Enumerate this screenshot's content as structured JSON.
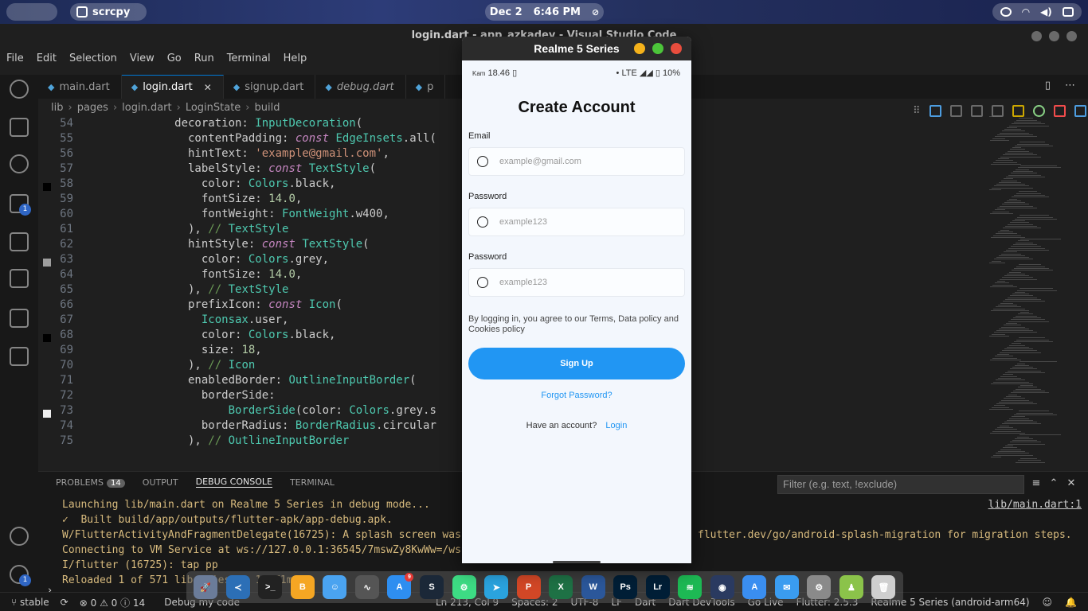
{
  "system_bar": {
    "app_name": "scrcpy",
    "date": "Dec 2",
    "time": "6:46 PM"
  },
  "vscode": {
    "title": "login.dart - app_azkadev - Visual Studio Code",
    "menu": [
      "File",
      "Edit",
      "Selection",
      "View",
      "Go",
      "Run",
      "Terminal",
      "Help"
    ],
    "activity_badges": {
      "debug": "1",
      "settings": "1"
    },
    "tabs": [
      {
        "label": "main.dart",
        "active": false
      },
      {
        "label": "login.dart",
        "active": true
      },
      {
        "label": "signup.dart",
        "active": false
      },
      {
        "label": "debug.dart",
        "active": false
      },
      {
        "label": "p",
        "active": false
      }
    ],
    "breadcrumb": [
      "lib",
      "pages",
      "login.dart",
      "LoginState",
      "build"
    ],
    "code_lines": [
      {
        "n": "54",
        "t": "            decoration: InputDecoration("
      },
      {
        "n": "55",
        "t": "              contentPadding: const EdgeInsets.all("
      },
      {
        "n": "56",
        "t": "              hintText: 'example@gmail.com',"
      },
      {
        "n": "57",
        "t": "              labelStyle: const TextStyle("
      },
      {
        "n": "58",
        "t": "                color: Colors.black,"
      },
      {
        "n": "59",
        "t": "                fontSize: 14.0,"
      },
      {
        "n": "60",
        "t": "                fontWeight: FontWeight.w400,"
      },
      {
        "n": "61",
        "t": "              ), // TextStyle"
      },
      {
        "n": "62",
        "t": "              hintStyle: const TextStyle("
      },
      {
        "n": "63",
        "t": "                color: Colors.grey,"
      },
      {
        "n": "64",
        "t": "                fontSize: 14.0,"
      },
      {
        "n": "65",
        "t": "              ), // TextStyle"
      },
      {
        "n": "66",
        "t": "              prefixIcon: const Icon("
      },
      {
        "n": "67",
        "t": "                Iconsax.user,"
      },
      {
        "n": "68",
        "t": "                color: Colors.black,"
      },
      {
        "n": "69",
        "t": "                size: 18,"
      },
      {
        "n": "70",
        "t": "              ), // Icon"
      },
      {
        "n": "71",
        "t": "              enabledBorder: OutlineInputBorder("
      },
      {
        "n": "72",
        "t": "                borderSide:"
      },
      {
        "n": "73",
        "t": "                    BorderSide(color: Colors.grey.s"
      },
      {
        "n": "74",
        "t": "                borderRadius: BorderRadius.circular"
      },
      {
        "n": "75",
        "t": "              ), // OutlineInputBorder"
      }
    ],
    "panel": {
      "tabs": [
        "PROBLEMS",
        "OUTPUT",
        "DEBUG CONSOLE",
        "TERMINAL"
      ],
      "problems_count": "14",
      "active_tab": "DEBUG CONSOLE",
      "filter_placeholder": "Filter (e.g. text, !exclude)",
      "console_lines": [
        "Launching lib/main.dart on Realme 5 Series in debug mode...",
        "✓  Built build/app/outputs/flutter-apk/app-debug.apk.",
        "W/FlutterActivityAndFragmentDelegate(16725): A splash screen was provide",
        "Connecting to VM Service at ws://127.0.0.1:36545/7mswZy8KwWw=/ws",
        "I/flutter (16725): tap pp",
        "Reloaded 1 of 571 libraries in 1,471ms."
      ],
      "console_extra": "flutter.dev/go/android-splash-migration for migration steps.",
      "console_link": "lib/main.dart:1"
    },
    "status": {
      "branch": "stable",
      "errors": "0",
      "warnings": "0",
      "info": "14",
      "debug_label": "Debug my code",
      "cursor": "Ln 213, Col 9",
      "spaces": "Spaces: 2",
      "encoding": "UTF-8",
      "eol": "LF",
      "lang": "Dart",
      "devtools": "Dart DevTools",
      "golive": "Go Live",
      "flutter": "Flutter: 2.5.3",
      "device": "Realme 5 Series (android-arm64)"
    }
  },
  "dock": {
    "apps": [
      {
        "name": "launchpad-icon",
        "color": "#6b7c99",
        "glyph": "🚀"
      },
      {
        "name": "vscode-icon",
        "color": "#2c6fb6",
        "glyph": "≺"
      },
      {
        "name": "terminal-icon",
        "color": "#222222",
        "glyph": ">_"
      },
      {
        "name": "brave-icon",
        "color": "#f5a623",
        "glyph": "B"
      },
      {
        "name": "finder-icon",
        "color": "#4aa3f0",
        "glyph": "☺"
      },
      {
        "name": "figma-icon",
        "color": "#555555",
        "glyph": "∿"
      },
      {
        "name": "appstore-icon",
        "color": "#2e8ef0",
        "glyph": "A",
        "badge": "9"
      },
      {
        "name": "steam-icon",
        "color": "#1b2838",
        "glyph": "S"
      },
      {
        "name": "android-studio-icon",
        "color": "#3ddc84",
        "glyph": "⚙"
      },
      {
        "name": "telegram-icon",
        "color": "#2aa3de",
        "glyph": "➤"
      },
      {
        "name": "powerpoint-icon",
        "color": "#d24726",
        "glyph": "P"
      },
      {
        "name": "excel-icon",
        "color": "#1e7145",
        "glyph": "X"
      },
      {
        "name": "word-icon",
        "color": "#2b579a",
        "glyph": "W"
      },
      {
        "name": "photoshop-icon",
        "color": "#001e36",
        "glyph": "Ps"
      },
      {
        "name": "lightroom-icon",
        "color": "#001e36",
        "glyph": "Lr"
      },
      {
        "name": "spotify-icon",
        "color": "#1db954",
        "glyph": "≋"
      },
      {
        "name": "screenshot-icon",
        "color": "#2a3a60",
        "glyph": "◉"
      },
      {
        "name": "xcode-icon",
        "color": "#3a8ef0",
        "glyph": "A"
      },
      {
        "name": "mail-icon",
        "color": "#3a9cf0",
        "glyph": "✉"
      },
      {
        "name": "settings-icon",
        "color": "#8a8a8a",
        "glyph": "⚙"
      },
      {
        "name": "android-icon",
        "color": "#8bc34a",
        "glyph": "♟"
      },
      {
        "name": "trash-icon",
        "color": "#cfcfcf",
        "glyph": "🗑"
      }
    ]
  },
  "phone": {
    "window_title": "Realme 5 Series",
    "status_day": "Kam",
    "status_time": "18.46",
    "status_net": "LTE",
    "status_battery": "10%",
    "title": "Create Account",
    "email_label": "Email",
    "email_placeholder": "example@gmail.com",
    "password_label": "Password",
    "password_placeholder": "example123",
    "password2_label": "Password",
    "password2_placeholder": "example123",
    "terms": "By logging in, you agree to our Terms, Data policy and Cookies policy",
    "signup_button": "Sign Up",
    "forgot": "Forgot Password?",
    "have_account": "Have an account?",
    "login_link": "Login"
  }
}
